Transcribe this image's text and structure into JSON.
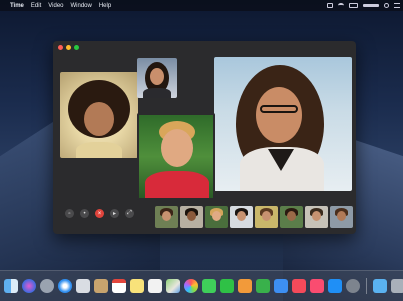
{
  "menubar": {
    "app_name": "Time",
    "items": [
      "Edit",
      "Video",
      "Window",
      "Help"
    ],
    "right_icons": [
      "airplay-icon",
      "wifi-icon",
      "battery-icon",
      "time-text",
      "search-icon",
      "menu-icon"
    ]
  },
  "window": {
    "controls": [
      {
        "name": "camera-icon",
        "glyph": "▫"
      },
      {
        "name": "mute-icon",
        "glyph": "•"
      },
      {
        "name": "end-call-icon",
        "glyph": "×"
      },
      {
        "name": "video-icon",
        "glyph": "▸"
      },
      {
        "name": "fullscreen-icon",
        "glyph": "⤢"
      }
    ],
    "thumbnail_count": 8
  },
  "dock": {
    "icons": [
      "finder-icon",
      "siri-icon",
      "launchpad-icon",
      "safari-icon",
      "mail-icon",
      "contacts-icon",
      "calendar-icon",
      "notes-icon",
      "reminders-icon",
      "maps-icon",
      "photos-icon",
      "messages-icon",
      "facetime-icon",
      "pages-icon",
      "numbers-icon",
      "keynote-icon",
      "news-icon",
      "music-icon",
      "app-store-icon",
      "system-preferences-icon",
      "downloads-folder-icon",
      "trash-icon"
    ]
  }
}
